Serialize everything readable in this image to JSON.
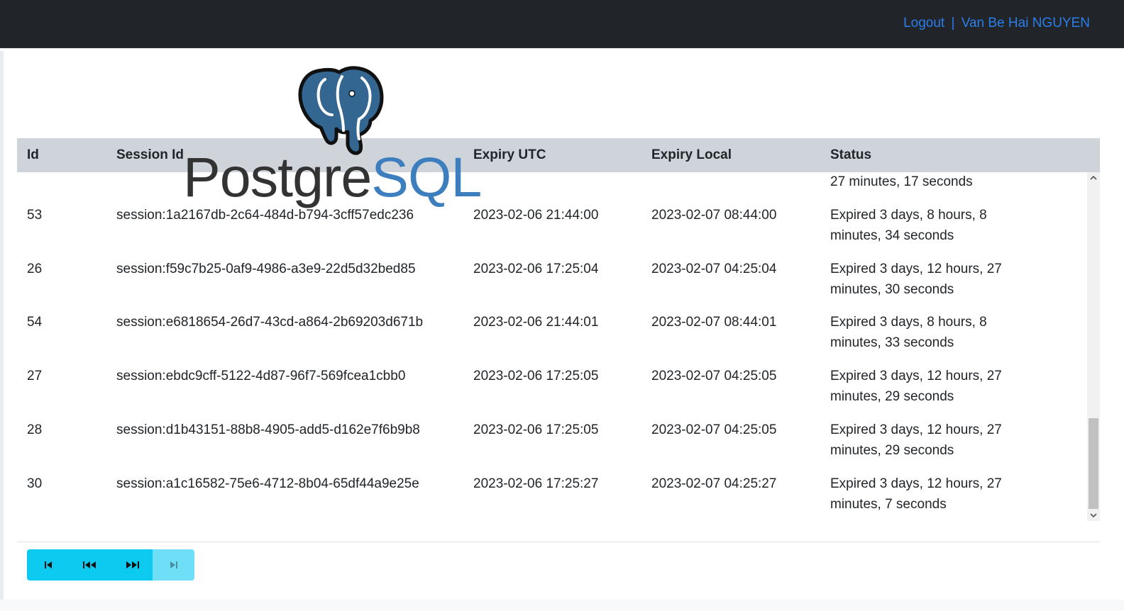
{
  "topbar": {
    "logout_label": "Logout",
    "separator": "|",
    "user_name": "Van Be Hai NGUYEN"
  },
  "logo": {
    "word_part1": "Postgre",
    "word_part2": "SQL",
    "colors": {
      "dark": "#333333",
      "blue": "#3d7ebf"
    }
  },
  "table": {
    "headers": {
      "id": "Id",
      "session_id": "Session Id",
      "expiry_utc": "Expiry UTC",
      "expiry_local": "Expiry Local",
      "status": "Status"
    },
    "partial_status": "27 minutes, 17 seconds",
    "rows": [
      {
        "id": "53",
        "session_id": "session:1a2167db-2c64-484d-b794-3cff57edc236",
        "expiry_utc": "2023-02-06 21:44:00",
        "expiry_local": "2023-02-07 08:44:00",
        "status": "Expired 3 days, 8 hours, 8 minutes, 34 seconds"
      },
      {
        "id": "26",
        "session_id": "session:f59c7b25-0af9-4986-a3e9-22d5d32bed85",
        "expiry_utc": "2023-02-06 17:25:04",
        "expiry_local": "2023-02-07 04:25:04",
        "status": "Expired 3 days, 12 hours, 27 minutes, 30 seconds"
      },
      {
        "id": "54",
        "session_id": "session:e6818654-26d7-43cd-a864-2b69203d671b",
        "expiry_utc": "2023-02-06 21:44:01",
        "expiry_local": "2023-02-07 08:44:01",
        "status": "Expired 3 days, 8 hours, 8 minutes, 33 seconds"
      },
      {
        "id": "27",
        "session_id": "session:ebdc9cff-5122-4d87-96f7-569fcea1cbb0",
        "expiry_utc": "2023-02-06 17:25:05",
        "expiry_local": "2023-02-07 04:25:05",
        "status": "Expired 3 days, 12 hours, 27 minutes, 29 seconds"
      },
      {
        "id": "28",
        "session_id": "session:d1b43151-88b8-4905-add5-d162e7f6b9b8",
        "expiry_utc": "2023-02-06 17:25:05",
        "expiry_local": "2023-02-07 04:25:05",
        "status": "Expired 3 days, 12 hours, 27 minutes, 29 seconds"
      },
      {
        "id": "30",
        "session_id": "session:a1c16582-75e6-4712-8b04-65df44a9e25e",
        "expiry_utc": "2023-02-06 17:25:27",
        "expiry_local": "2023-02-07 04:25:27",
        "status": "Expired 3 days, 12 hours, 27 minutes, 7 seconds"
      }
    ]
  },
  "scrollbar": {
    "up_icon": "chevron-up-icon",
    "down_icon": "chevron-down-icon"
  },
  "pagination": {
    "buttons": [
      {
        "icon": "first-page-icon",
        "enabled": true
      },
      {
        "icon": "previous-page-icon",
        "enabled": true
      },
      {
        "icon": "next-page-icon",
        "enabled": true
      },
      {
        "icon": "last-page-icon",
        "enabled": false
      }
    ],
    "colors": {
      "active": "#0dcaf0",
      "disabled": "#6edff6"
    }
  }
}
